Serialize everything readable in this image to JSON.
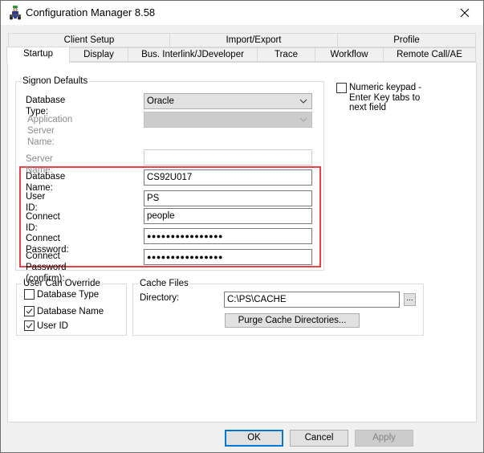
{
  "window": {
    "title": "Configuration Manager 8.58",
    "icon": "configuration-manager-app-icon",
    "close_icon": "close-icon"
  },
  "tabs": {
    "row1": [
      {
        "label": "Client Setup"
      },
      {
        "label": "Import/Export"
      },
      {
        "label": "Profile"
      }
    ],
    "row2": [
      {
        "label": "Startup",
        "active": true
      },
      {
        "label": "Display"
      },
      {
        "label": "Bus. Interlink/JDeveloper"
      },
      {
        "label": "Trace"
      },
      {
        "label": "Workflow"
      },
      {
        "label": "Remote Call/AE"
      }
    ]
  },
  "signon": {
    "legend": "Signon Defaults",
    "database_type": {
      "label": "Database Type:",
      "value": "Oracle"
    },
    "app_server_name": {
      "label": "Application Server Name:",
      "value": "",
      "disabled": true
    },
    "server_name": {
      "label": "Server Name:",
      "value": "",
      "disabled": true
    },
    "database_name": {
      "label": "Database Name:",
      "value": "CS92U017"
    },
    "user_id": {
      "label": "User ID:",
      "value": "PS"
    },
    "connect_id": {
      "label": "Connect ID:",
      "value": "people"
    },
    "connect_password": {
      "label": "Connect Password:",
      "value": "●●●●●●●●●●●●●●●●"
    },
    "connect_password_confirm": {
      "label": "Connect Password (confirm):",
      "value": "●●●●●●●●●●●●●●●●"
    },
    "highlight_color": "#e8414a"
  },
  "numeric_keypad": {
    "label_line1": "Numeric keypad -",
    "label_line2": "Enter Key tabs to",
    "label_line3": "next field",
    "checked": false
  },
  "user_can_override": {
    "legend": "User Can Override",
    "items": [
      {
        "label": "Database Type",
        "checked": false
      },
      {
        "label": "Database Name",
        "checked": true
      },
      {
        "label": "User ID",
        "checked": true
      }
    ]
  },
  "cache_files": {
    "legend": "Cache Files",
    "directory_label": "Directory:",
    "directory_value": "C:\\PS\\CACHE",
    "browse_label": "...",
    "purge_label": "Purge Cache Directories..."
  },
  "buttons": {
    "ok": "OK",
    "cancel": "Cancel",
    "apply": "Apply"
  },
  "colors": {
    "accent": "#0078d7",
    "highlight": "#e8414a"
  }
}
